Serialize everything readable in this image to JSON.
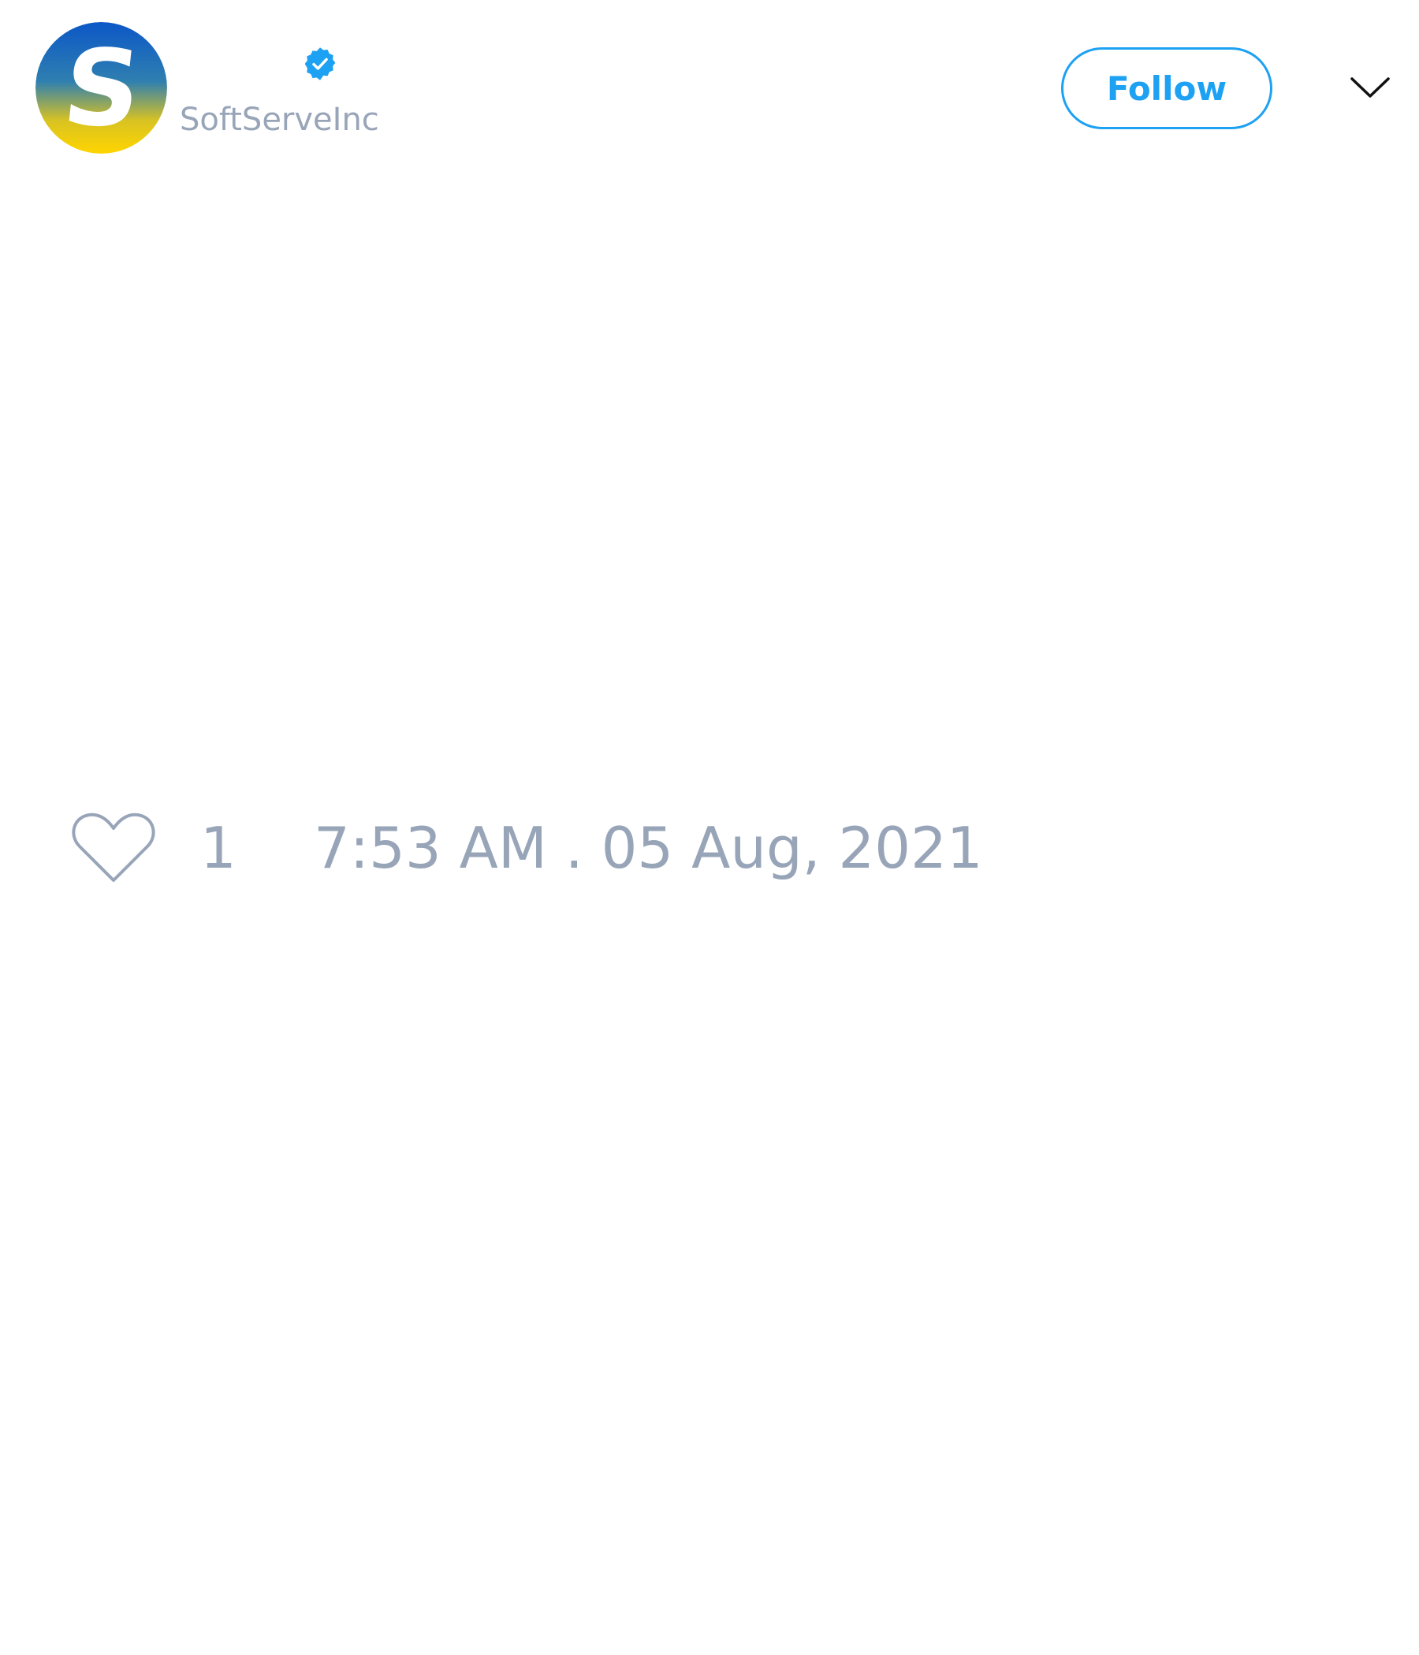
{
  "header": {
    "avatar": {
      "icon": "softserve-logo-icon",
      "letter": "S",
      "gradient_top": "#0b57c7",
      "gradient_bottom": "#ffd500"
    },
    "verified_icon": "verified-badge-icon",
    "handle": "SoftServeInc",
    "follow_label": "Follow",
    "menu_icon": "chevron-down-icon"
  },
  "footer": {
    "like_icon": "heart-outline-icon",
    "like_count": "1",
    "timestamp": "7:53 AM . 05 Aug, 2021"
  },
  "colors": {
    "accent": "#1da1f2",
    "muted_text": "#98a5b8",
    "background": "#ffffff"
  }
}
